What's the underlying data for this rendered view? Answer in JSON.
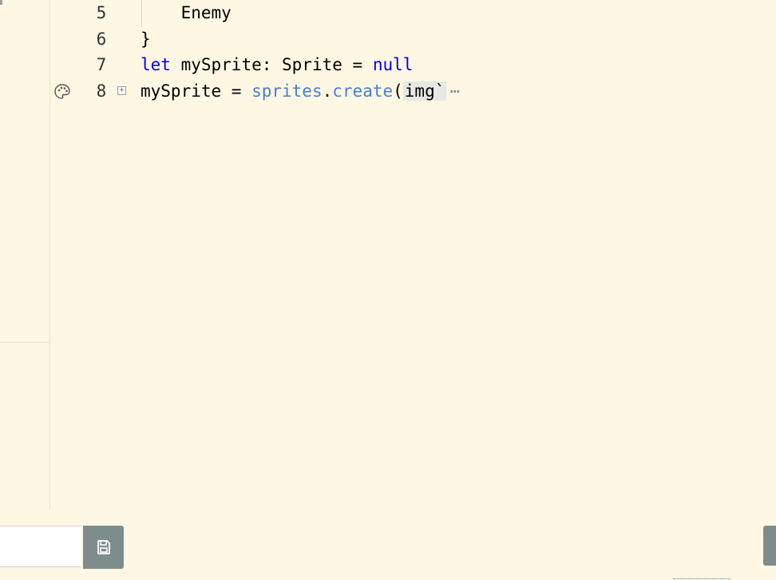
{
  "editor": {
    "lines": [
      {
        "number": "5",
        "text": "    Enemy"
      },
      {
        "number": "6",
        "text": "}"
      },
      {
        "number": "7",
        "kw_let": "let",
        "rest": " mySprite: Sprite = ",
        "kw_null": "null"
      },
      {
        "number": "8",
        "var": "mySprite",
        "eq": " = ",
        "ns": "sprites",
        "dot": ".",
        "fn": "create",
        "paren": "(",
        "arg": "img`",
        "ellipsis": "⋯",
        "fold_symbol": "+"
      }
    ],
    "gutter_icon": "palette-icon"
  },
  "bottom": {
    "filename_placeholder": "",
    "save_icon": "save-icon"
  },
  "colors": {
    "background": "#fdf7e4",
    "keyword": "#0000e0",
    "function": "#4a7fd0",
    "button": "#7d8d8b"
  }
}
